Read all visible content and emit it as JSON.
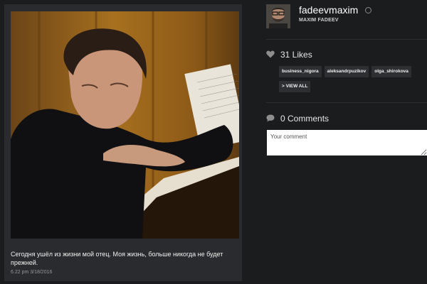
{
  "post": {
    "caption": "Сегодня ушёл из жизни мой отец. Моя жизнь, больше никогда не будет прежней.",
    "timestamp": "6.22 pm 3/18/2016"
  },
  "profile": {
    "username": "fadeevmaxim",
    "full_name": "MAXIM FADEEV"
  },
  "likes": {
    "label": "31 Likes",
    "likers": [
      "business_nigora",
      "aleksandrpuzikov",
      "olga_shirokova"
    ],
    "view_all_label": "> VIEW ALL"
  },
  "comments": {
    "label": "0 Comments",
    "placeholder": "Your comment"
  },
  "icons": {
    "likes": "heart-icon",
    "comments": "speech-bubble-icon",
    "verified": "circle-icon"
  },
  "colors": {
    "background": "#1b1c1e",
    "card": "#2a2b2e",
    "tag": "#2e2f33"
  }
}
